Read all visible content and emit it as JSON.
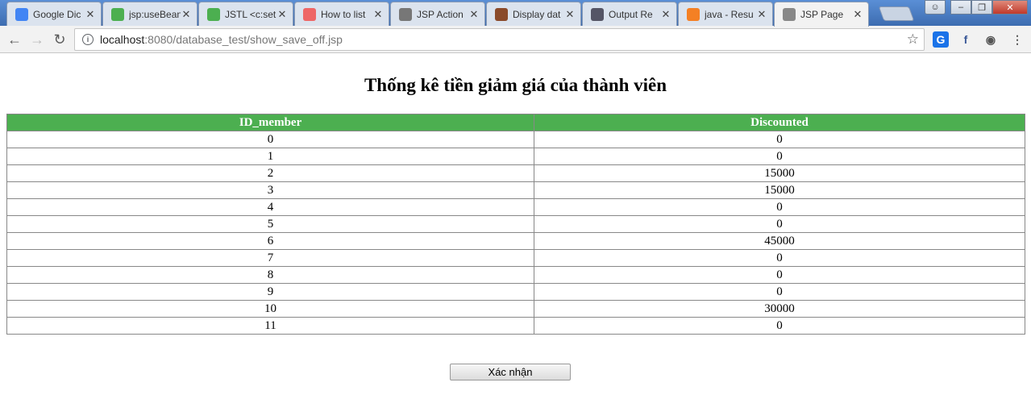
{
  "browser": {
    "tabs": [
      {
        "label": "Google Dic",
        "icon": "google-icon",
        "color": "#4285f4"
      },
      {
        "label": "jsp:useBean",
        "icon": "b-icon",
        "color": "#4caf50"
      },
      {
        "label": "JSTL <c:set",
        "icon": "b-icon",
        "color": "#4caf50"
      },
      {
        "label": "How to list",
        "icon": "j-icon",
        "color": "#e66"
      },
      {
        "label": "JSP Action",
        "icon": "diamond-icon",
        "color": "#777"
      },
      {
        "label": "Display dat",
        "icon": "horseshoe-icon",
        "color": "#8a4a2a"
      },
      {
        "label": "Output Re",
        "icon": "document-icon",
        "color": "#556"
      },
      {
        "label": "java - Resu",
        "icon": "stackoverflow-icon",
        "color": "#f48024"
      },
      {
        "label": "JSP Page",
        "icon": "page-icon",
        "color": "#888",
        "active": true
      }
    ],
    "url_host": "localhost",
    "url_path": ":8080/database_test/show_save_off.jsp"
  },
  "page": {
    "title": "Thống kê tiền giảm giá của thành viên",
    "columns": [
      "ID_member",
      "Discounted"
    ],
    "rows": [
      [
        "0",
        "0"
      ],
      [
        "1",
        "0"
      ],
      [
        "2",
        "15000"
      ],
      [
        "3",
        "15000"
      ],
      [
        "4",
        "0"
      ],
      [
        "5",
        "0"
      ],
      [
        "6",
        "45000"
      ],
      [
        "7",
        "0"
      ],
      [
        "8",
        "0"
      ],
      [
        "9",
        "0"
      ],
      [
        "10",
        "30000"
      ],
      [
        "11",
        "0"
      ]
    ],
    "button_label": "Xác nhận"
  },
  "colors": {
    "header_bg": "#4caf50",
    "header_text": "#ffffff"
  }
}
